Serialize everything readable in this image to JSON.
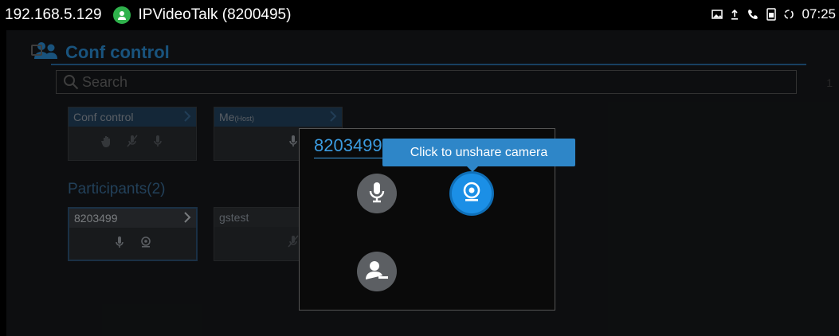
{
  "status_bar": {
    "ip": "192.168.5.129",
    "app_name": "IPVideoTalk (8200495)",
    "time": "07:25",
    "icons": [
      "picture-icon",
      "upload-icon",
      "phone-icon",
      "sim-icon",
      "sync-icon"
    ]
  },
  "header": {
    "title": "Conf control"
  },
  "search": {
    "placeholder": "Search"
  },
  "side_glyph": "1",
  "cards": {
    "conf_control": {
      "label": "Conf control",
      "icons": [
        "hand-icon",
        "mic-muted-icon",
        "mic-icon"
      ]
    },
    "me": {
      "label": "Me",
      "badge": "(Host)",
      "icons": [
        "mic-icon",
        "camera-icon"
      ]
    },
    "p1": {
      "label": "8203499",
      "icons": [
        "mic-icon",
        "camera-icon"
      ]
    },
    "p2": {
      "label": "gstest",
      "icons": [
        "mic-muted-icon",
        "camera-icon"
      ]
    }
  },
  "participants": {
    "title": "Participants(2)"
  },
  "modal": {
    "title": "8203499",
    "tooltip": "Click to unshare camera",
    "buttons": [
      "mic-icon",
      "camera-icon",
      "remove-user-icon"
    ]
  },
  "colors": {
    "accent": "#2e86c8",
    "active_button": "#1b8fe6",
    "header_title": "#2b8fd8"
  }
}
